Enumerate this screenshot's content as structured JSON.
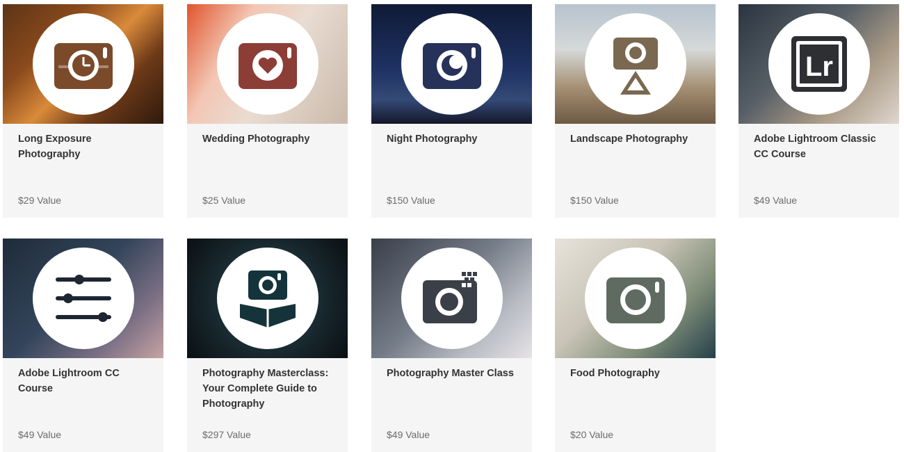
{
  "courses": [
    {
      "title": "Long Exposure Photography",
      "value": "$29 Value",
      "icon": "camera-clock-icon",
      "color": "#7b4a2a"
    },
    {
      "title": "Wedding Photography",
      "value": "$25 Value",
      "icon": "camera-heart-icon",
      "color": "#a5514a"
    },
    {
      "title": "Night Photography",
      "value": "$150 Value",
      "icon": "camera-moon-icon",
      "color": "#26325a"
    },
    {
      "title": "Landscape Photography",
      "value": "$150 Value",
      "icon": "camera-tripod-icon",
      "color": "#7a6850"
    },
    {
      "title": "Adobe Lightroom Classic CC Course",
      "value": "$49 Value",
      "icon": "lightroom-logo-icon",
      "color": "#2d2f33"
    },
    {
      "title": "Adobe Lightroom CC Course",
      "value": "$49 Value",
      "icon": "sliders-icon",
      "color": "#1e2633"
    },
    {
      "title": "Photography Masterclass: Your Complete Guide to Photography",
      "value": "$297 Value",
      "icon": "camera-book-icon",
      "color": "#15333a"
    },
    {
      "title": "Photography Master Class",
      "value": "$49 Value",
      "icon": "camera-pixel-icon",
      "color": "#3b3f48"
    },
    {
      "title": "Food Photography",
      "value": "$20 Value",
      "icon": "camera-icon",
      "color": "#5f6b60"
    }
  ]
}
